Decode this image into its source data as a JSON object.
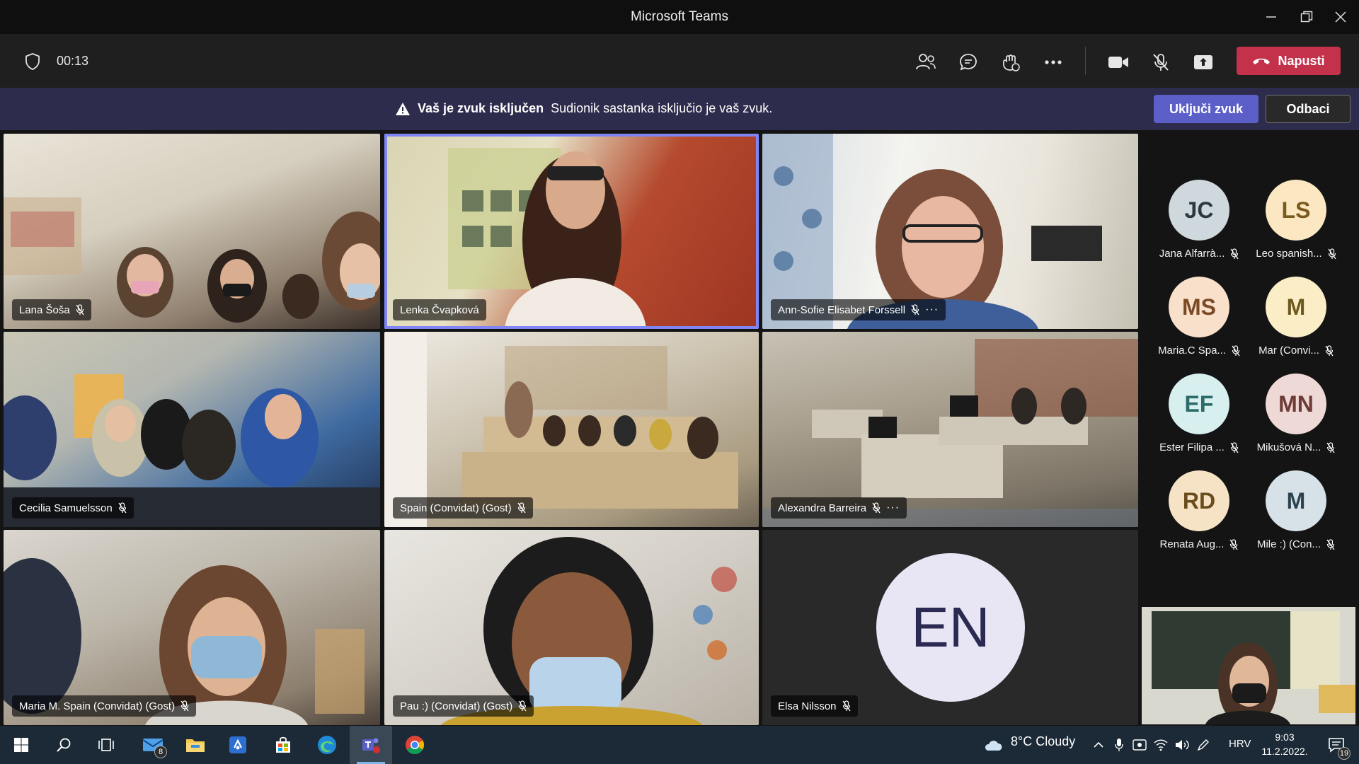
{
  "window": {
    "title": "Microsoft Teams"
  },
  "toolbar": {
    "timer": "00:13",
    "leave_label": "Napusti"
  },
  "banner": {
    "title": "Vaš je zvuk isključen",
    "message": "Sudionik sastanka isključio je vaš zvuk.",
    "unmute_label": "Uključi zvuk",
    "dismiss_label": "Odbaci"
  },
  "tiles": [
    {
      "name": "Lana Šoša"
    },
    {
      "name": "Lenka Čvapková"
    },
    {
      "name": "Ann-Sofie Elisabet Forssell"
    },
    {
      "name": "Cecilia Samuelsson"
    },
    {
      "name": "Spain (Convidat) (Gost)"
    },
    {
      "name": "Alexandra Barreira"
    },
    {
      "name": "Maria M. Spain (Convidat) (Gost)"
    },
    {
      "name": "Pau :) (Convidat) (Gost)"
    },
    {
      "name": "Elsa Nilsson",
      "initials": "EN"
    }
  ],
  "rail": [
    {
      "initials": "JC",
      "label": "Jana Alfarrà...",
      "bg": "#cfd8dc",
      "fg": "#2b3a42"
    },
    {
      "initials": "LS",
      "label": "Leo spanish...",
      "bg": "#fbe8c2",
      "fg": "#7a5a1e"
    },
    {
      "initials": "MS",
      "label": "Maria.C Spa...",
      "bg": "#f9e0cb",
      "fg": "#7a4a25"
    },
    {
      "initials": "M",
      "label": "Mar (Convi...",
      "bg": "#fbeec7",
      "fg": "#6e5a1f"
    },
    {
      "initials": "EF",
      "label": "Ester Filipa ...",
      "bg": "#d7efef",
      "fg": "#2d6a6a"
    },
    {
      "initials": "MN",
      "label": "Mikušová N...",
      "bg": "#eed9d7",
      "fg": "#6e3b36"
    },
    {
      "initials": "RD",
      "label": "Renata Aug...",
      "bg": "#f6e3c6",
      "fg": "#6a4c1d"
    },
    {
      "initials": "M",
      "label": "Mile :) (Con...",
      "bg": "#d6e2e8",
      "fg": "#2b4250"
    }
  ],
  "taskbar": {
    "mail_badge": "8",
    "weather": "8°C  Cloudy",
    "language": "HRV",
    "time": "9:03",
    "date": "11.2.2022.",
    "notif_badge": "19"
  }
}
